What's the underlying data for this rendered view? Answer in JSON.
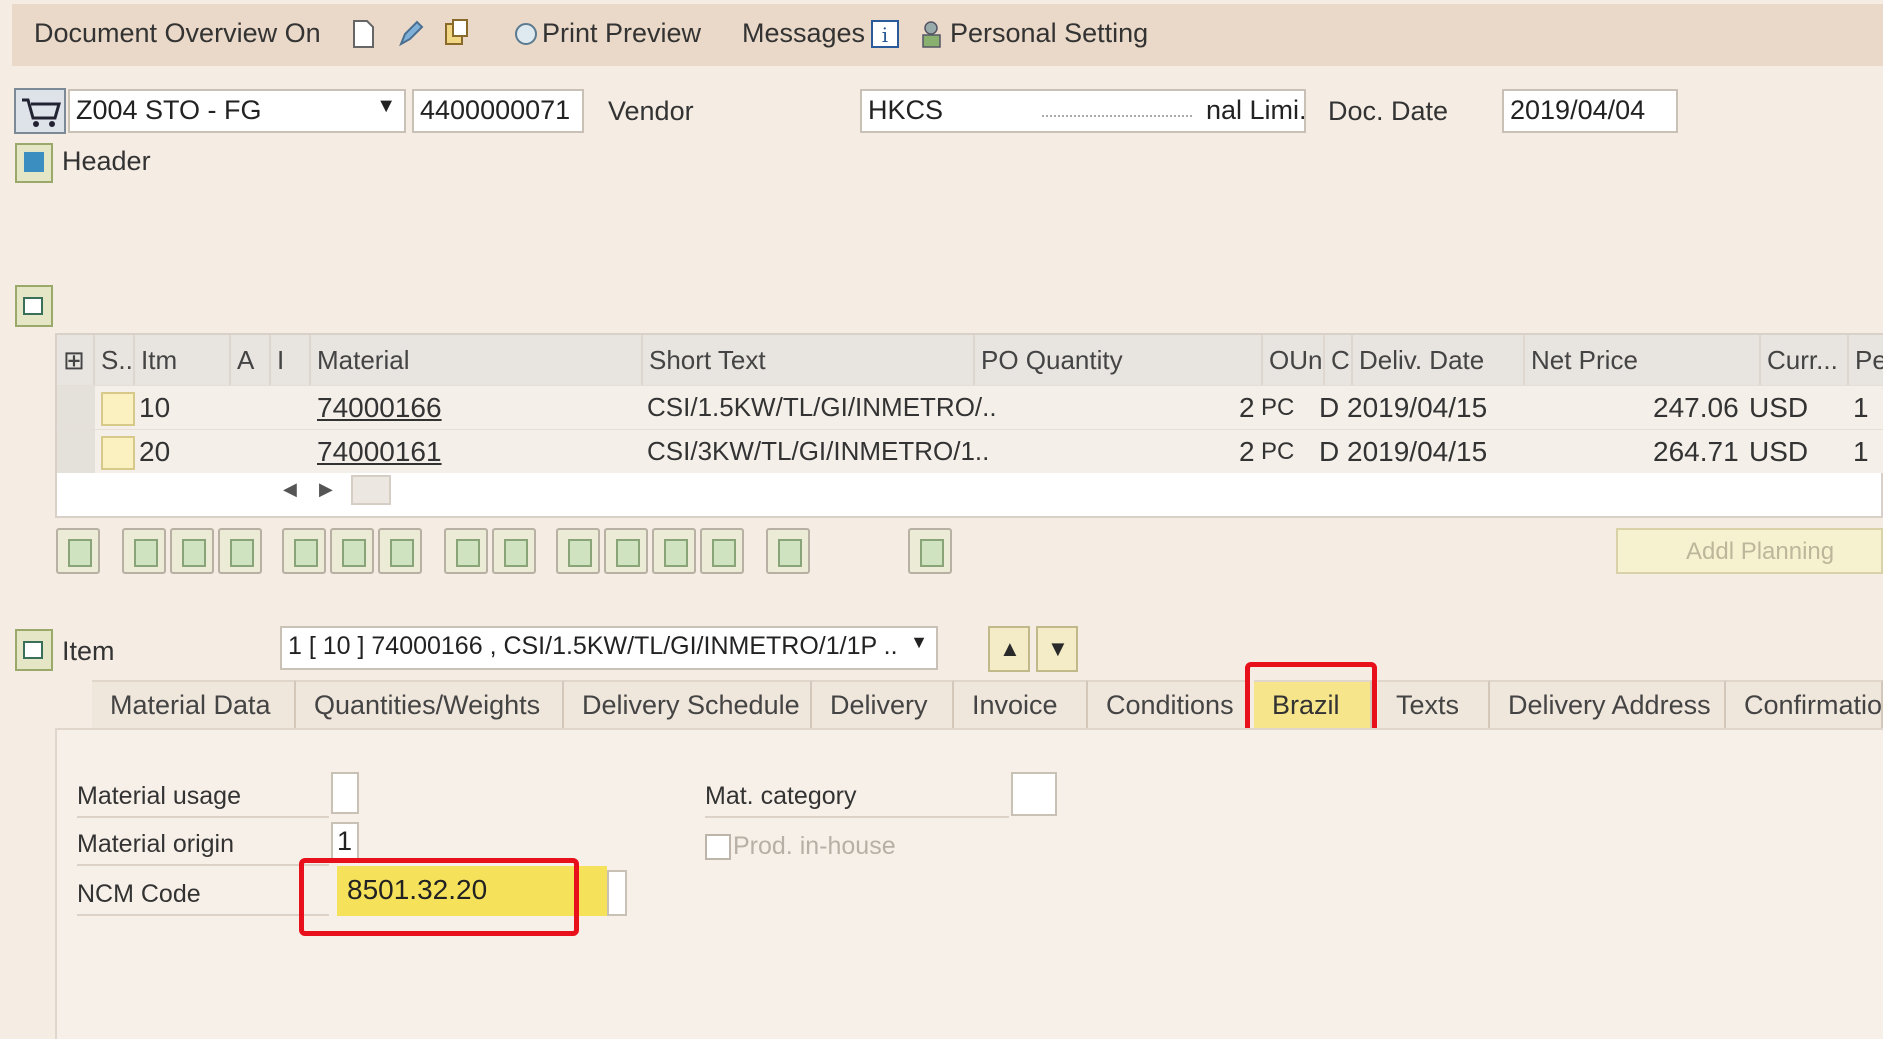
{
  "menubar": {
    "document_overview": "Document Overview On",
    "print_preview": "Print Preview",
    "messages": "Messages",
    "personal_setting": "Personal Setting"
  },
  "header": {
    "doc_type": "Z004 STO - FG",
    "doc_number": "4400000071",
    "vendor_label": "Vendor",
    "vendor_value": "HKCS",
    "vendor_suffix": "nal Limi..",
    "doc_date_label": "Doc. Date",
    "doc_date_value": "2019/04/04",
    "header_label": "Header"
  },
  "grid": {
    "columns": [
      "S..",
      "Itm",
      "A",
      "I",
      "Material",
      "Short Text",
      "PO Quantity",
      "OUn",
      "C",
      "Deliv. Date",
      "Net Price",
      "Curr...",
      "Per"
    ],
    "rows": [
      {
        "itm": "10",
        "material": "74000166",
        "short_text": "CSI/1.5KW/TL/GI/INMETRO/..",
        "qty": "2",
        "oun": "PC",
        "c": "D",
        "deliv": "2019/04/15",
        "price": "247.06",
        "curr": "USD",
        "per": "1"
      },
      {
        "itm": "20",
        "material": "74000161",
        "short_text": "CSI/3KW/TL/GI/INMETRO/1..",
        "qty": "2",
        "oun": "PC",
        "c": "D",
        "deliv": "2019/04/15",
        "price": "264.71",
        "curr": "USD",
        "per": "1"
      }
    ]
  },
  "toolbar": {
    "addl_planning": "Addl Planning"
  },
  "item": {
    "label": "Item",
    "selector": "1 [ 10 ] 74000166 , CSI/1.5KW/TL/GI/INMETRO/1/1P .."
  },
  "tabs": [
    "Material Data",
    "Quantities/Weights",
    "Delivery Schedule",
    "Delivery",
    "Invoice",
    "Conditions",
    "Brazil",
    "Texts",
    "Delivery Address",
    "Confirmation"
  ],
  "brazil_tab": {
    "material_usage_label": "Material usage",
    "material_usage_value": "",
    "material_origin_label": "Material origin",
    "material_origin_value": "1",
    "ncm_code_label": "NCM Code",
    "ncm_code_value": "8501.32.20",
    "mat_category_label": "Mat. category",
    "prod_inhouse_label": "Prod. in-house"
  },
  "colors": {
    "highlight_red": "#e8101a",
    "highlight_yellow": "#f6e25a"
  }
}
